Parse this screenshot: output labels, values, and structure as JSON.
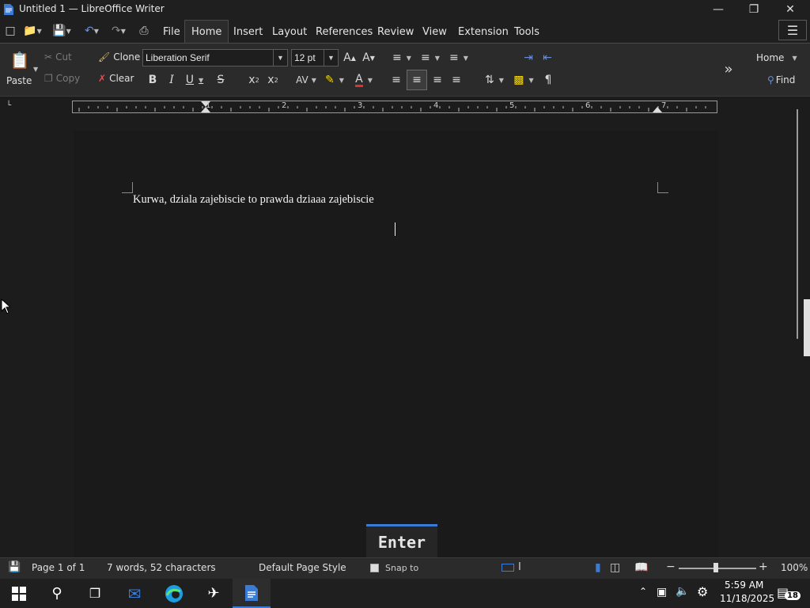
{
  "window": {
    "title": "Untitled 1 — LibreOffice Writer"
  },
  "menu_tabs": [
    {
      "label": "File"
    },
    {
      "label": "Home"
    },
    {
      "label": "Insert"
    },
    {
      "label": "Layout"
    },
    {
      "label": "References"
    },
    {
      "label": "Review"
    },
    {
      "label": "View"
    },
    {
      "label": "Extension"
    },
    {
      "label": "Tools"
    }
  ],
  "ribbon": {
    "paste": "Paste",
    "cut": "Cut",
    "copy": "Copy",
    "clone": "Clone",
    "clear": "Clear",
    "font_name": "Liberation Serif",
    "font_size": "12 pt",
    "home_dropdown": "Home",
    "find": "Find"
  },
  "ruler": {
    "numbers": [
      "1",
      "2",
      "3",
      "4",
      "5",
      "6",
      "7"
    ]
  },
  "document": {
    "text": "Kurwa, dziala zajebiscie to prawda dziaaa zajebiscie"
  },
  "overlay": {
    "key_label": "Enter"
  },
  "statusbar": {
    "page": "Page 1 of 1",
    "words": "7 words, 52 characters",
    "page_style": "Default Page Style",
    "snap": "Snap to",
    "zoom": "100%"
  },
  "taskbar": {
    "time": "5:59 AM",
    "date": "11/18/2025",
    "notifications": "18"
  },
  "colors": {
    "accent": "#3a7bd5",
    "font_color_red": "#e03030",
    "highlight_yellow": "#f5d800"
  }
}
